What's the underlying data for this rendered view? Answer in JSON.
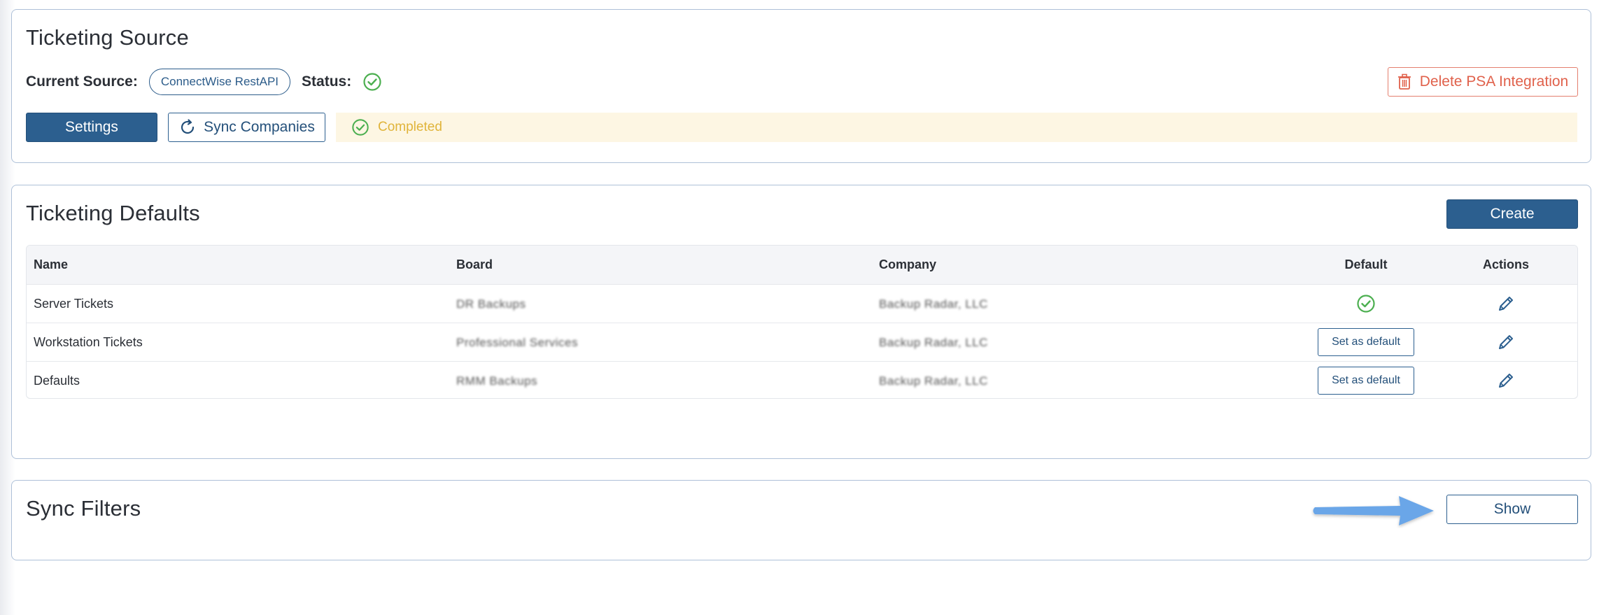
{
  "ticketing_source": {
    "title": "Ticketing Source",
    "current_source_label": "Current Source:",
    "current_source_value": "ConnectWise RestAPI",
    "status_label": "Status:",
    "status_icon": "check-circle-icon",
    "delete_button": "Delete PSA Integration",
    "settings_button": "Settings",
    "sync_button": "Sync Companies",
    "sync_status": "Completed",
    "colors": {
      "danger": "#e0614b",
      "primary": "#2c5f8f",
      "success": "#4caf50",
      "warning_text": "#e0b43a",
      "warning_bg": "#fdf6e3"
    }
  },
  "ticketing_defaults": {
    "title": "Ticketing Defaults",
    "create_button": "Create",
    "columns": [
      "Name",
      "Board",
      "Company",
      "Default",
      "Actions"
    ],
    "rows": [
      {
        "name": "Server Tickets",
        "board": "DR Backups",
        "company": "Backup Radar, LLC",
        "is_default": true,
        "default_action": ""
      },
      {
        "name": "Workstation Tickets",
        "board": "Professional Services",
        "company": "Backup Radar, LLC",
        "is_default": false,
        "default_action": "Set as default"
      },
      {
        "name": "Defaults",
        "board": "RMM Backups",
        "company": "Backup Radar, LLC",
        "is_default": false,
        "default_action": "Set as default"
      }
    ]
  },
  "sync_filters": {
    "title": "Sync Filters",
    "show_button": "Show"
  }
}
